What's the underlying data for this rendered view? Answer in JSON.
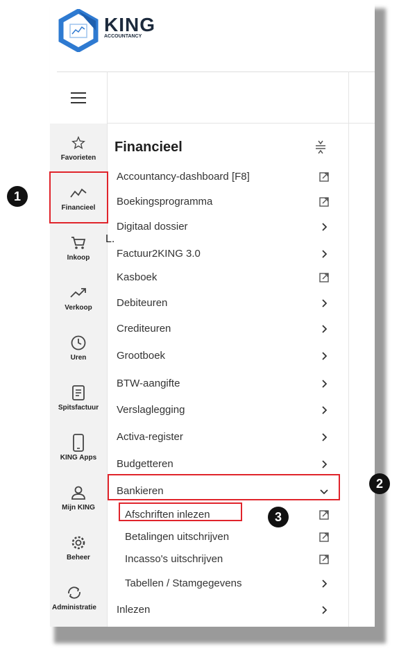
{
  "logo": {
    "title": "KING",
    "subtitle": "ACCOUNTANCY"
  },
  "rail": {
    "items": [
      {
        "label": "Favorieten",
        "icon": "star-icon"
      },
      {
        "label": "Financieel",
        "icon": "chart-line-icon"
      },
      {
        "label": "Inkoop",
        "icon": "cart-icon"
      },
      {
        "label": "Verkoop",
        "icon": "trend-up-icon"
      },
      {
        "label": "Uren",
        "icon": "clock-icon"
      },
      {
        "label": "Spitsfactuur",
        "icon": "document-icon"
      },
      {
        "label": "KING Apps",
        "icon": "phone-icon"
      },
      {
        "label": "Mijn KING",
        "icon": "user-icon"
      },
      {
        "label": "Beheer",
        "icon": "gear-icon"
      },
      {
        "label": "Administratie",
        "icon": "sync-icon"
      }
    ]
  },
  "menu": {
    "title": "Financieel",
    "items": [
      {
        "label": "Accountancy-dashboard [F8]",
        "icon": "external-link-icon"
      },
      {
        "label": "Boekingsprogramma",
        "icon": "external-link-icon"
      },
      {
        "label": "Digitaal dossier",
        "icon": "chevron-right-icon"
      },
      {
        "label": "Factuur2KING 3.0",
        "icon": "chevron-right-icon"
      },
      {
        "label": "Kasboek",
        "icon": "external-link-icon"
      },
      {
        "label": "Debiteuren",
        "icon": "chevron-right-icon"
      },
      {
        "label": "Crediteuren",
        "icon": "chevron-right-icon"
      },
      {
        "label": "Grootboek",
        "icon": "chevron-right-icon"
      },
      {
        "label": "BTW-aangifte",
        "icon": "chevron-right-icon"
      },
      {
        "label": "Verslaglegging",
        "icon": "chevron-right-icon"
      },
      {
        "label": "Activa-register",
        "icon": "chevron-right-icon"
      },
      {
        "label": "Budgetteren",
        "icon": "chevron-right-icon"
      },
      {
        "label": "Bankieren",
        "icon": "chevron-down-icon"
      },
      {
        "label": "Inlezen",
        "icon": "chevron-right-icon"
      }
    ],
    "bankieren_sub": [
      {
        "label": "Afschriften inlezen",
        "icon": "external-link-icon"
      },
      {
        "label": "Betalingen uitschrijven",
        "icon": "external-link-icon"
      },
      {
        "label": "Incasso's uitschrijven",
        "icon": "external-link-icon"
      },
      {
        "label": "Tabellen / Stamgegevens",
        "icon": "chevron-right-icon"
      }
    ]
  },
  "annotations": {
    "badge1": "1",
    "badge2": "2",
    "badge3": "3",
    "stray": "L."
  },
  "colors": {
    "highlight_red": "#e0242b",
    "logo_blue": "#2e7ad1",
    "rail_bg": "#f2f2f2"
  }
}
